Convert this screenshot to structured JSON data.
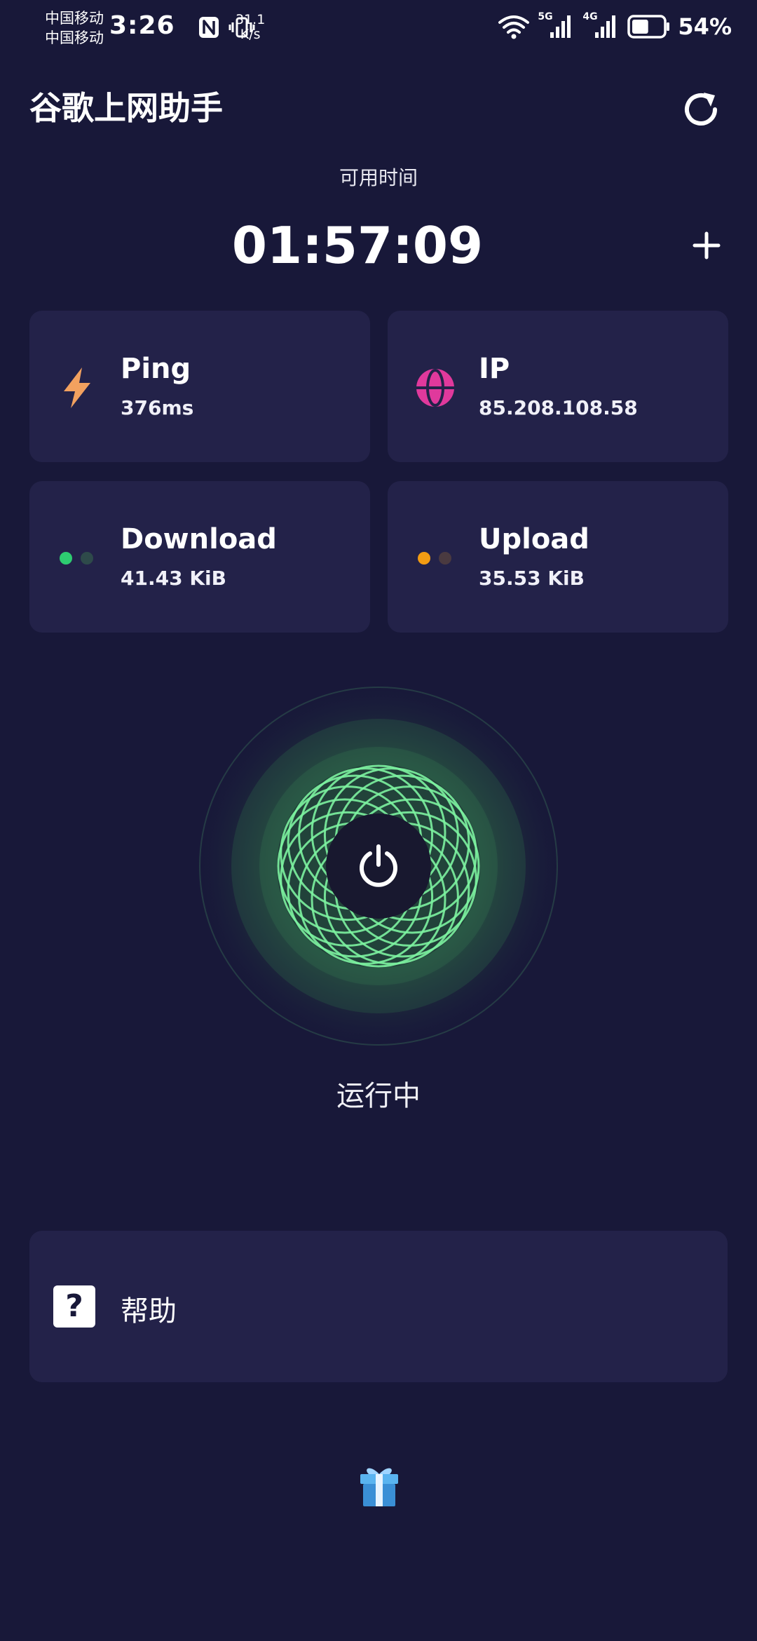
{
  "status_bar": {
    "carrier_1": "中国移动",
    "carrier_2": "中国移动",
    "time": "3:26",
    "net_speed_value": "31.1",
    "net_speed_unit": "K/s",
    "sim1_network": "5G",
    "sim2_network": "4G",
    "battery_percent": "54%",
    "battery_level": 0.54
  },
  "header": {
    "title": "谷歌上网助手",
    "refresh_icon": "refresh-icon"
  },
  "timer": {
    "label": "可用时间",
    "value": "01:57:09",
    "add_icon": "plus-icon"
  },
  "stats": [
    {
      "title": "Ping",
      "value": "376ms",
      "icon": "lightning-icon",
      "color": "#f2a15f"
    },
    {
      "title": "IP",
      "value": "85.208.108.58",
      "icon": "globe-icon",
      "color": "#e0399c"
    },
    {
      "title": "Download",
      "value": "41.43 KiB",
      "icon": "download-dots-icon",
      "color": "#2ecc71"
    },
    {
      "title": "Upload",
      "value": "35.53 KiB",
      "icon": "upload-dots-icon",
      "color": "#f39c12"
    }
  ],
  "connection": {
    "status": "运行中",
    "power_icon": "power-icon",
    "accent": "#7cf2a0"
  },
  "help": {
    "label": "帮助",
    "icon": "question-icon",
    "icon_glyph": "?"
  },
  "footer": {
    "gift_icon": "gift-icon"
  }
}
